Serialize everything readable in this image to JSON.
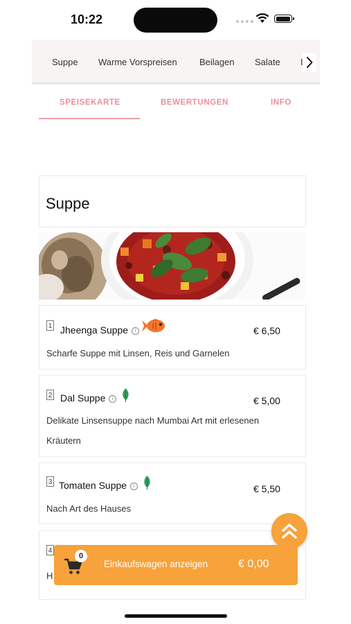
{
  "status_bar": {
    "time": "10:22"
  },
  "categories": {
    "items": [
      "Suppe",
      "Warme Vorspreisen",
      "Beilagen",
      "Salate",
      "I"
    ],
    "next_icon": "chevron-right-icon"
  },
  "tabs": [
    {
      "label": "SPEISEKARTE",
      "active": true
    },
    {
      "label": "BEWERTUNGEN",
      "active": false
    },
    {
      "label": "INFO",
      "active": false
    }
  ],
  "section": {
    "title": "Suppe"
  },
  "dishes": [
    {
      "number": "1",
      "name": "Jheenga Suppe",
      "price": "€ 6,50",
      "description": "Scharfe Suppe mit Linsen, Reis und Garnelen",
      "badge_icon": "fish-icon"
    },
    {
      "number": "2",
      "name": "Dal Suppe",
      "price": "€ 5,00",
      "description_lines": [
        "Delikate Linsensuppe nach Mumbai Art mit erlesenen",
        "Kräutern"
      ],
      "badge_icon": "leaf-icon"
    },
    {
      "number": "3",
      "name": "Tomaten Suppe",
      "price": "€ 5,50",
      "description": "Nach Art des Hauses",
      "badge_icon": "leaf-icon"
    },
    {
      "number": "4",
      "description_partial": "H"
    }
  ],
  "cart": {
    "count": "0",
    "label": "Einkaufswagen anzeigen",
    "total": "€ 0,00",
    "icon": "cart-icon"
  },
  "colors": {
    "accent_orange": "#f7a23a",
    "tab_pink": "#ea8f9a",
    "leaf_green": "#2e9e58",
    "fish_orange": "#f2762a"
  }
}
